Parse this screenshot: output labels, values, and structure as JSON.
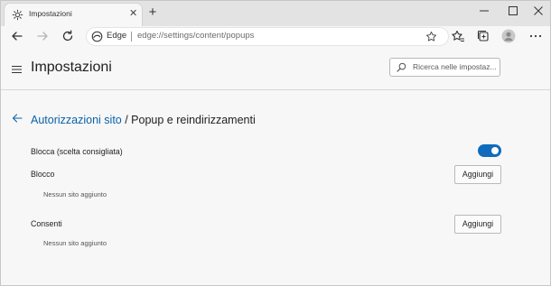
{
  "tab": {
    "title": "Impostazioni",
    "close_glyph": "✕"
  },
  "new_tab_glyph": "+",
  "window_controls": {
    "minimize": "—",
    "maximize": "☐",
    "close": "✕"
  },
  "address_bar": {
    "site_label": "Edge",
    "url": "edge://settings/content/popups"
  },
  "header": {
    "title": "Impostazioni",
    "search_placeholder": "Ricerca nelle impostaz..."
  },
  "breadcrumb": {
    "parent": "Autorizzazioni sito",
    "separator": " / ",
    "current": "Popup e reindirizzamenti"
  },
  "settings": {
    "block_toggle": {
      "label": "Blocca (scelta consigliata)",
      "on": true
    },
    "block_section": {
      "label": "Blocco",
      "add_button": "Aggiungi",
      "empty": "Nessun sito aggiunto"
    },
    "allow_section": {
      "label": "Consenti",
      "add_button": "Aggiungi",
      "empty": "Nessun sito aggiunto"
    }
  },
  "colors": {
    "accent": "#0f6cbd",
    "link": "#0a62a8"
  },
  "icons": [
    "gear-icon",
    "back-icon",
    "forward-icon",
    "refresh-icon",
    "edge-icon",
    "star-icon",
    "favorites-icon",
    "collections-icon",
    "profile-icon",
    "more-icon",
    "menu-icon",
    "search-icon",
    "arrow-left-icon"
  ]
}
